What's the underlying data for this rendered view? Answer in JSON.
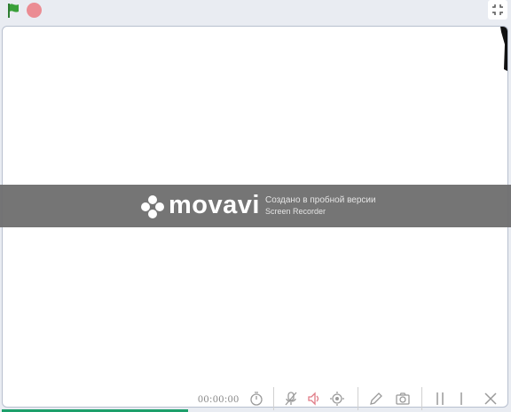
{
  "toolbar": {
    "green_flag_icon": "green-flag-icon",
    "stop_icon": "stop-icon",
    "fullscreen_icon": "exit-fullscreen-icon"
  },
  "watermark": {
    "brand": "movavi",
    "line1": "Создано в пробной версии",
    "line2": "Screen Recorder"
  },
  "recorder": {
    "time": "00:00:00"
  },
  "colors": {
    "flag_green": "#3aa03a",
    "stop_pink": "#eb8c93",
    "stage_border": "#b8c0cf",
    "status_green": "#1d9f6b"
  }
}
